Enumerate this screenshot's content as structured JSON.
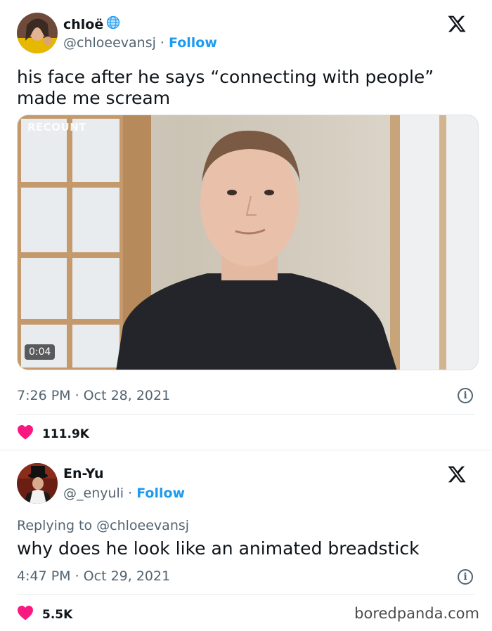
{
  "tweet1": {
    "display_name": "chloë",
    "handle": "@chloeevansj",
    "separator": " · ",
    "follow_label": "Follow",
    "text": "his face after he says “connecting with people” made me scream",
    "video": {
      "watermark": "RECOUNT",
      "duration": "0:04"
    },
    "timestamp": "7:26 PM · Oct 28, 2021",
    "likes": "111.9K",
    "icons": {
      "verified": "globe-badge-icon",
      "logo": "x-logo-icon",
      "info": "info-icon",
      "like": "heart-icon"
    }
  },
  "tweet2": {
    "display_name": "En-Yu",
    "handle": "@_enyuli",
    "separator": " · ",
    "follow_label": "Follow",
    "reply_prefix": "Replying to ",
    "reply_to": "@chloeevansj",
    "text": "why does he look like an animated breadstick",
    "timestamp": "4:47 PM · Oct 29, 2021",
    "likes": "5.5K",
    "icons": {
      "logo": "x-logo-icon",
      "info": "info-icon",
      "like": "heart-icon"
    }
  },
  "watermark": "boredpanda.com",
  "colors": {
    "link": "#1d9bf0",
    "like": "#f91880",
    "muted": "#536471",
    "text": "#0f1419"
  }
}
